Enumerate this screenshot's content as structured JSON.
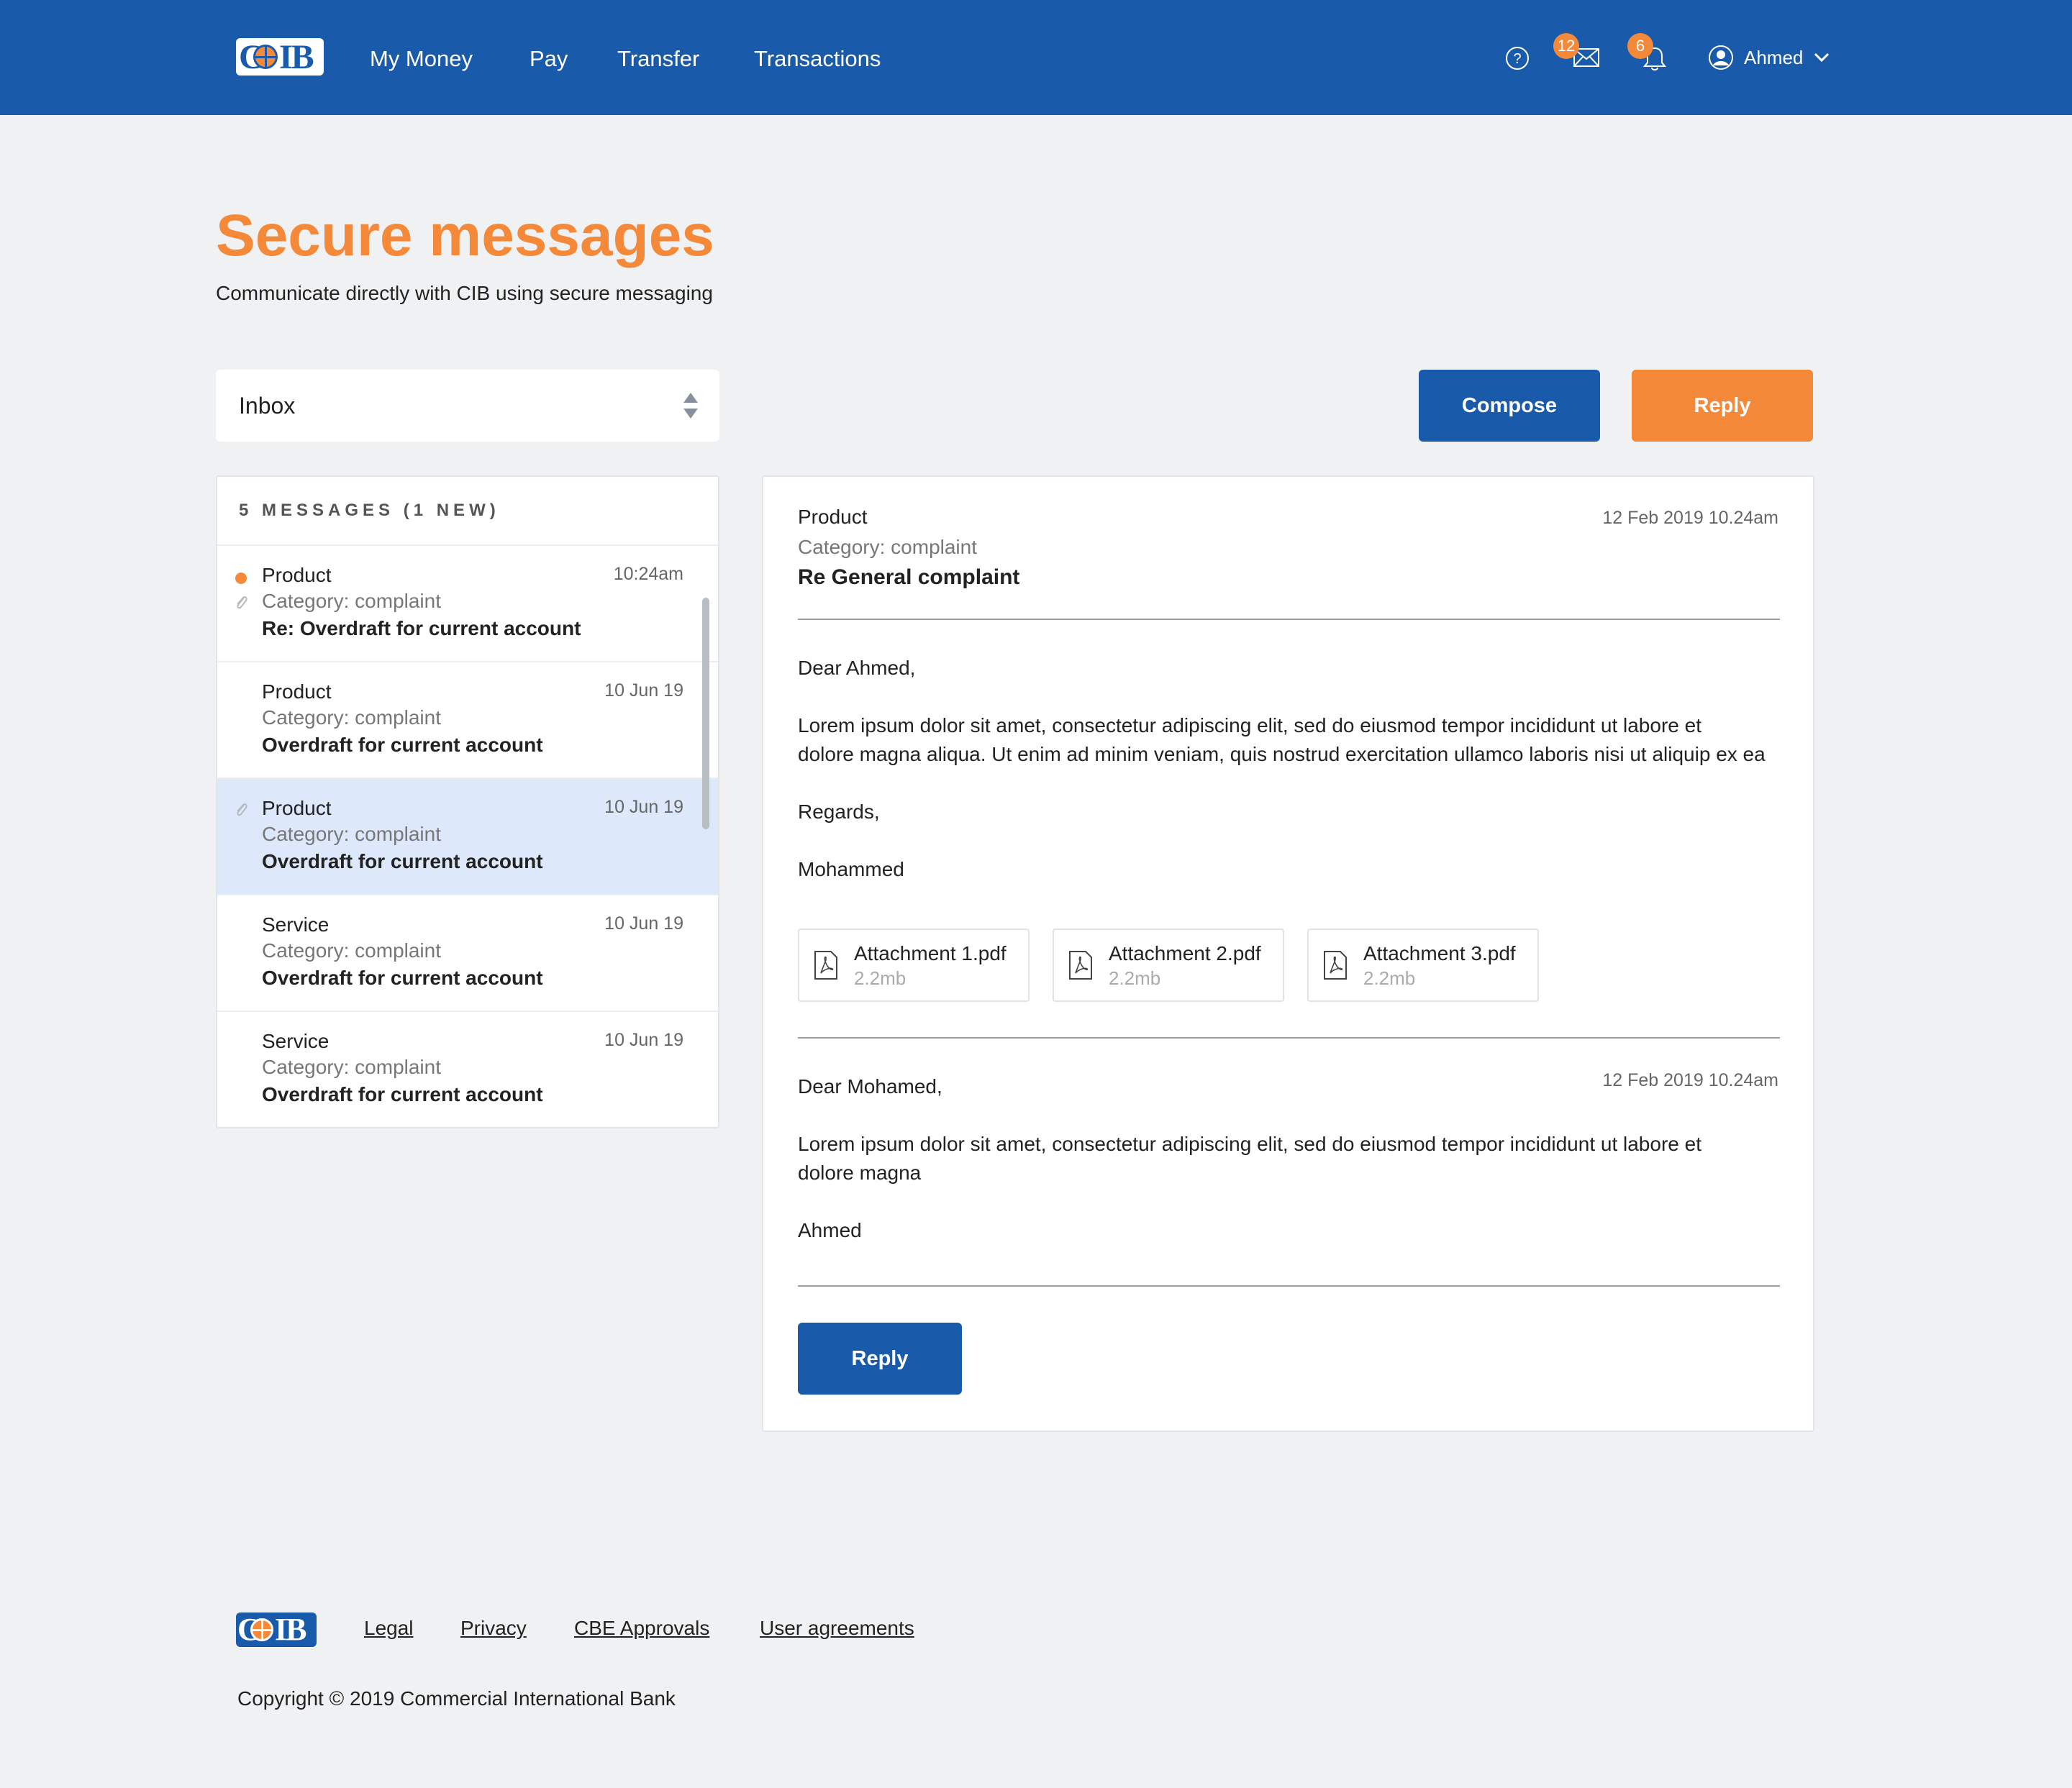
{
  "nav": {
    "logo_text": "CIB",
    "items": [
      "My Money",
      "Pay",
      "Transfer",
      "Transactions"
    ],
    "mail_count": "12",
    "notification_count": "6",
    "user_name": "Ahmed"
  },
  "page": {
    "title": "Secure messages",
    "subtitle": "Communicate directly with CIB using secure messaging"
  },
  "folder_select": {
    "value": "Inbox"
  },
  "buttons": {
    "compose": "Compose",
    "reply_top": "Reply",
    "reply_bottom": "Reply"
  },
  "messages": {
    "header": "5 MESSAGES (1 NEW)",
    "items": [
      {
        "category": "Product",
        "sub": "Category: complaint",
        "title": "Re: Overdraft for current account",
        "date": "10:24am",
        "unread": true,
        "attachment": true
      },
      {
        "category": "Product",
        "sub": "Category: complaint",
        "title": "Overdraft for current account",
        "date": "10 Jun 19",
        "unread": false,
        "attachment": false
      },
      {
        "category": "Product",
        "sub": "Category: complaint",
        "title": "Overdraft for current account",
        "date": "10 Jun 19",
        "unread": false,
        "attachment": true,
        "selected": true
      },
      {
        "category": "Service",
        "sub": "Category: complaint",
        "title": "Overdraft for current account",
        "date": "10 Jun 19",
        "unread": false,
        "attachment": false
      },
      {
        "category": "Service",
        "sub": "Category: complaint",
        "title": "Overdraft for current account",
        "date": "10 Jun 19",
        "unread": false,
        "attachment": false
      }
    ]
  },
  "detail": {
    "product": "Product",
    "category": "Category:  complaint",
    "subject": "Re General complaint",
    "date": "12 Feb 2019 10.24am",
    "first": {
      "greeting": "Dear Ahmed,",
      "body_line1": "Lorem ipsum dolor sit amet, consectetur adipiscing elit, sed do eiusmod tempor incididunt ut labore et",
      "body_line2": "dolore magna aliqua. Ut enim ad minim veniam, quis nostrud exercitation ullamco laboris nisi ut aliquip ex ea",
      "closing": "Regards,",
      "signature": "Mohammed",
      "attachments": [
        {
          "name": "Attachment 1.pdf",
          "size": "2.2mb"
        },
        {
          "name": "Attachment 2.pdf",
          "size": "2.2mb"
        },
        {
          "name": "Attachment 3.pdf",
          "size": "2.2mb"
        }
      ]
    },
    "second": {
      "greeting": "Dear Mohamed,",
      "date": "12 Feb 2019 10.24am",
      "body_line1": "Lorem ipsum dolor sit amet, consectetur adipiscing elit, sed do eiusmod tempor incididunt ut labore et",
      "body_line2": "dolore magna",
      "signature": "Ahmed"
    }
  },
  "footer": {
    "links": [
      "Legal",
      "Privacy",
      "CBE Approvals",
      "User agreements"
    ],
    "copyright": "Copyright © 2019 Commercial International Bank"
  },
  "colors": {
    "brand_blue": "#1a5aaa",
    "accent_orange": "#f5893a",
    "selected_row": "#dde9fa",
    "background": "#f0f1f3"
  },
  "icons": [
    "help-icon",
    "mail-icon",
    "bell-icon",
    "user-avatar-icon",
    "chevron-down-icon",
    "select-arrows-icon",
    "paperclip-icon",
    "pdf-icon"
  ]
}
